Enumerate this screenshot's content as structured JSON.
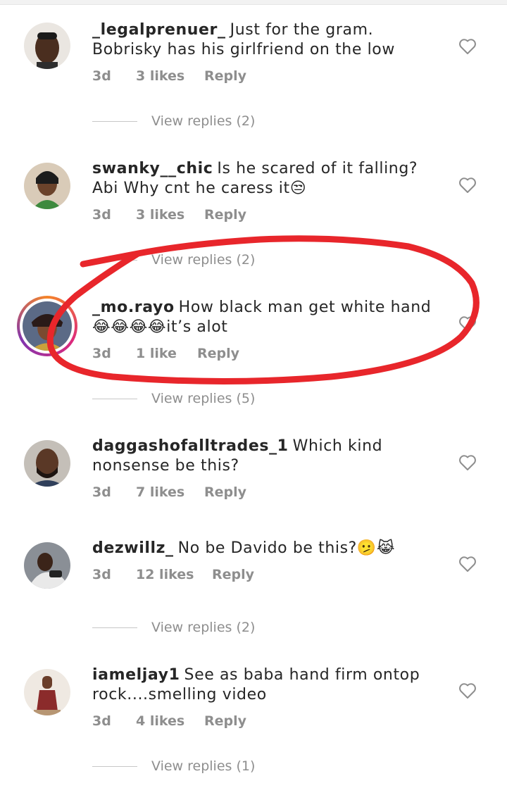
{
  "comments": [
    {
      "username": "_legalprenuer_",
      "text": "Just for the gram. Bobrisky has his girlfriend on the low",
      "time": "3d",
      "likes": "3 likes",
      "reply": "Reply",
      "view_replies": "View replies (2)"
    },
    {
      "username": "swanky__chic",
      "text": "Is he scared of it falling? Abi Why cnt he caress it😒",
      "time": "3d",
      "likes": "3 likes",
      "reply": "Reply",
      "view_replies": "View replies (2)"
    },
    {
      "username": "_mo.rayo",
      "text": "How black man get white hand😂😂😂😂it’s alot",
      "time": "3d",
      "likes": "1 like",
      "reply": "Reply",
      "view_replies": "View replies (5)"
    },
    {
      "username": "daggashofalltrades_1",
      "text": "Which kind nonsense be this?",
      "time": "3d",
      "likes": "7 likes",
      "reply": "Reply",
      "view_replies": ""
    },
    {
      "username": "dezwillz_",
      "text": "No be Davido be this?🫤😹",
      "time": "3d",
      "likes": "12 likes",
      "reply": "Reply",
      "view_replies": "View replies (2)"
    },
    {
      "username": "iameljay1",
      "text": "See as baba hand firm ontop rock....smelling video",
      "time": "3d",
      "likes": "4 likes",
      "reply": "Reply",
      "view_replies": "View replies (1)"
    }
  ],
  "colors": {
    "annotation": "#e8262b",
    "muted": "#8e8e8e",
    "story_ring": "#dd2a7b"
  },
  "icons": {
    "like": "heart-outline-icon"
  }
}
